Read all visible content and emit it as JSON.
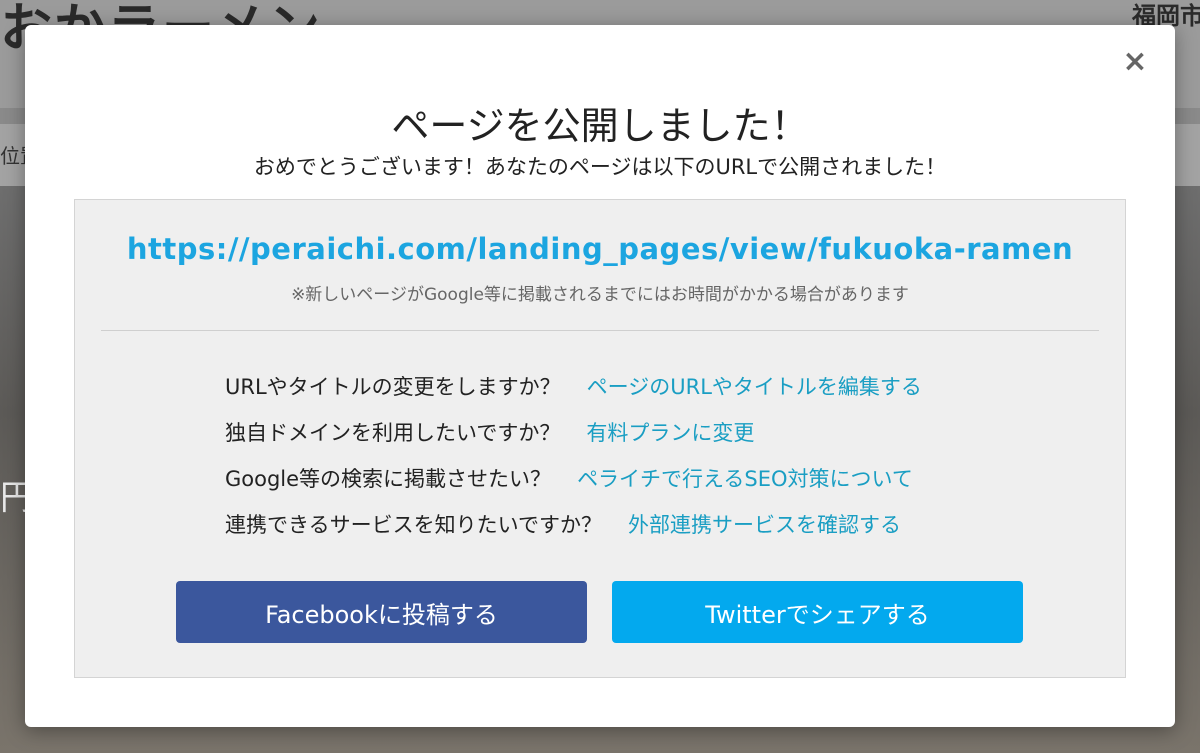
{
  "background": {
    "logo_text": "おかラーメン",
    "region_text": "福岡市",
    "subbar_text": "位置",
    "side_text": "円八"
  },
  "modal": {
    "close_icon": "×",
    "title": "ページを公開しました！",
    "subtitle": "おめでとうございます！あなたのページは以下のURLで公開されました！",
    "url": "https://peraichi.com/landing_pages/view/fukuoka-ramen",
    "url_note": "※新しいページがGoogle等に掲載されるまでにはお時間がかかる場合があります",
    "faq": [
      {
        "question": "URLやタイトルの変更をしますか？",
        "link": "ページのURLやタイトルを編集する"
      },
      {
        "question": "独自ドメインを利用したいですか？",
        "link": "有料プランに変更"
      },
      {
        "question": "Google等の検索に掲載させたい？",
        "link": "ペライチで行えるSEO対策について"
      },
      {
        "question": "連携できるサービスを知りたいですか？",
        "link": "外部連携サービスを確認する"
      }
    ],
    "facebook_button": "Facebookに投稿する",
    "twitter_button": "Twitterでシェアする"
  },
  "colors": {
    "url": "#1ca5e0",
    "link": "#1a9ec3",
    "facebook": "#3b579d",
    "twitter": "#03a9ee"
  }
}
